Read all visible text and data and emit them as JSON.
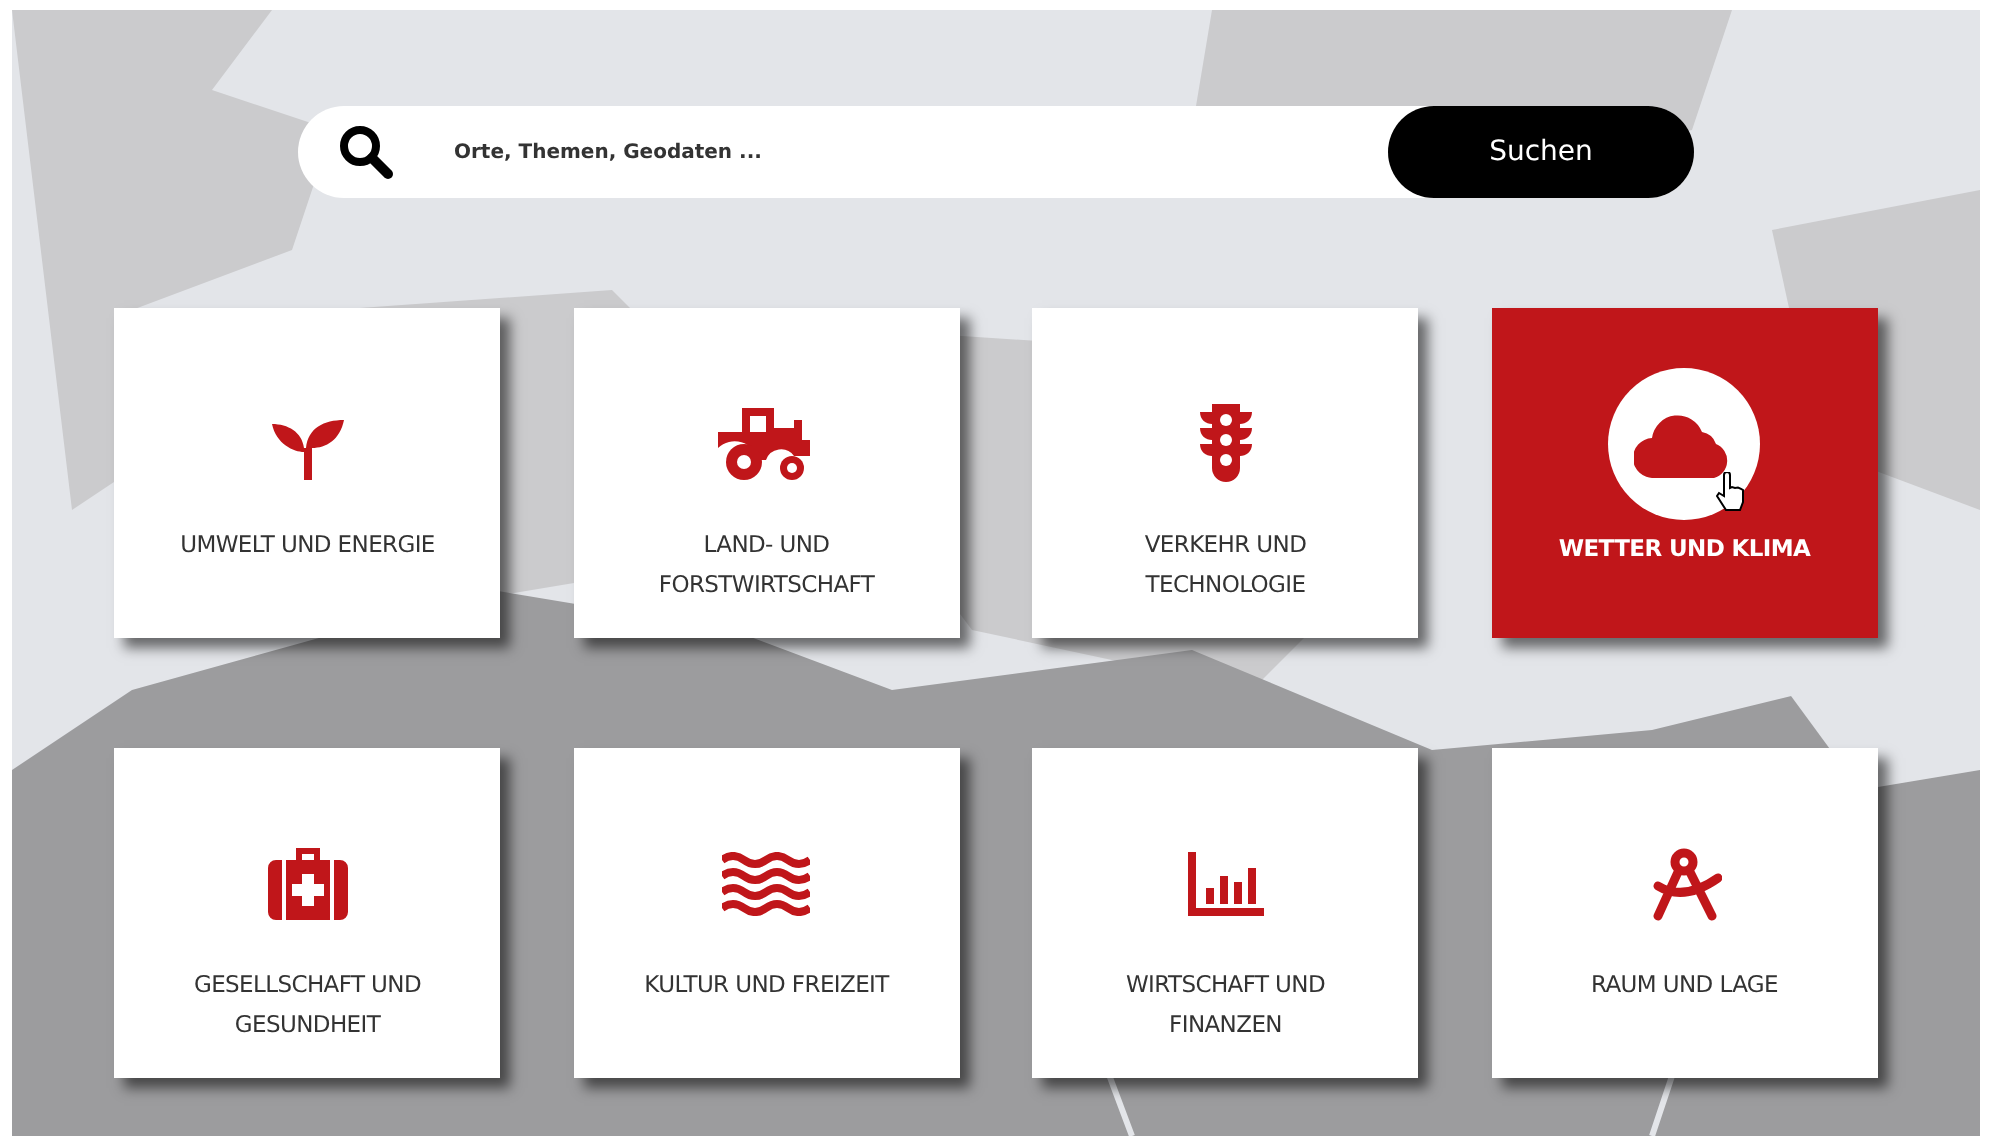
{
  "search": {
    "placeholder": "Orte, Themen, Geodaten ...",
    "button": "Suchen"
  },
  "tiles": [
    {
      "label": "UMWELT UND ENERGIE",
      "selected": false
    },
    {
      "label": "LAND- UND\nFORSTWIRTSCHAFT",
      "selected": false
    },
    {
      "label": "VERKEHR UND\nTECHNOLOGIE",
      "selected": false
    },
    {
      "label": "WETTER UND KLIMA",
      "selected": true
    },
    {
      "label": "GESELLSCHAFT UND\nGESUNDHEIT",
      "selected": false
    },
    {
      "label": "KULTUR UND FREIZEIT",
      "selected": false
    },
    {
      "label": "WIRTSCHAFT UND\nFINANZEN",
      "selected": false
    },
    {
      "label": "RAUM UND LAGE",
      "selected": false
    }
  ]
}
